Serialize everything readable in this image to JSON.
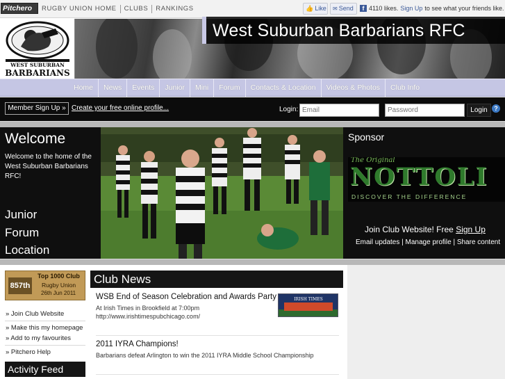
{
  "topbar": {
    "brand": "Pitchero",
    "links": [
      "Rugby Union Home",
      "Clubs",
      "Rankings"
    ],
    "facebook": {
      "like_label": "Like",
      "send_label": "Send",
      "likes_text": "4110 likes.",
      "signup_label": "Sign Up",
      "signup_suffix": "to see what your friends like."
    }
  },
  "header": {
    "club_name": "West Suburban Barbarians RFC",
    "logo_text_top": "WEST SUBURBAN",
    "logo_text_bottom": "BARBARIANS"
  },
  "nav": {
    "items": [
      "Home",
      "News",
      "Events",
      "Junior",
      "Mini",
      "Forum",
      "Contacts & Location",
      "Videos & Photos",
      "Club Info"
    ]
  },
  "login": {
    "member_signup": "Member Sign Up »",
    "create_profile": "Create your free online profile...",
    "label": "Login:",
    "email_placeholder": "Email",
    "password_placeholder": "Password",
    "button": "Login",
    "help": "?"
  },
  "hero": {
    "title": "Welcome",
    "text": "Welcome to the home of the West Suburban Barbarians RFC!",
    "links": [
      "Junior",
      "Forum",
      "Location"
    ],
    "sponsor_title": "Sponsor",
    "sponsor_ad": {
      "line1": "The Original",
      "brand": "NOTTOLI",
      "tagline": "DISCOVER THE DIFFERENCE"
    },
    "join_text": "Join Club Website! Free",
    "join_signup": "Sign Up",
    "join_sub": "Email updates | Manage profile | Share content"
  },
  "sidebar": {
    "badge": {
      "rank": "857th",
      "title": "Top 1000 Club",
      "sport": "Rugby Union",
      "date": "26th Jun 2011"
    },
    "links": [
      "» Join Club Website",
      "» Make this my homepage",
      "» Add to my favourites",
      "» Pitchero Help"
    ],
    "activity_title": "Activity Feed"
  },
  "news": {
    "title": "Club News",
    "items": [
      {
        "headline": "WSB End of Season Celebration and Awards Party",
        "line1": "At Irish Times in Brookfield at 7:00pm",
        "line2": "http://www.irishtimespubchicago.com/",
        "thumb_text": "IRISH TIMES"
      },
      {
        "headline": "2011 IYRA Champions!",
        "line1": "Barbarians defeat Arlington to win the 2011 IYRA Middle School Championship"
      }
    ]
  },
  "colors": {
    "nav_bg": "#c5c6e4",
    "dark_bg": "#0f0f0f",
    "facebook_blue": "#3b5998",
    "badge_gold": "#c19a57"
  }
}
